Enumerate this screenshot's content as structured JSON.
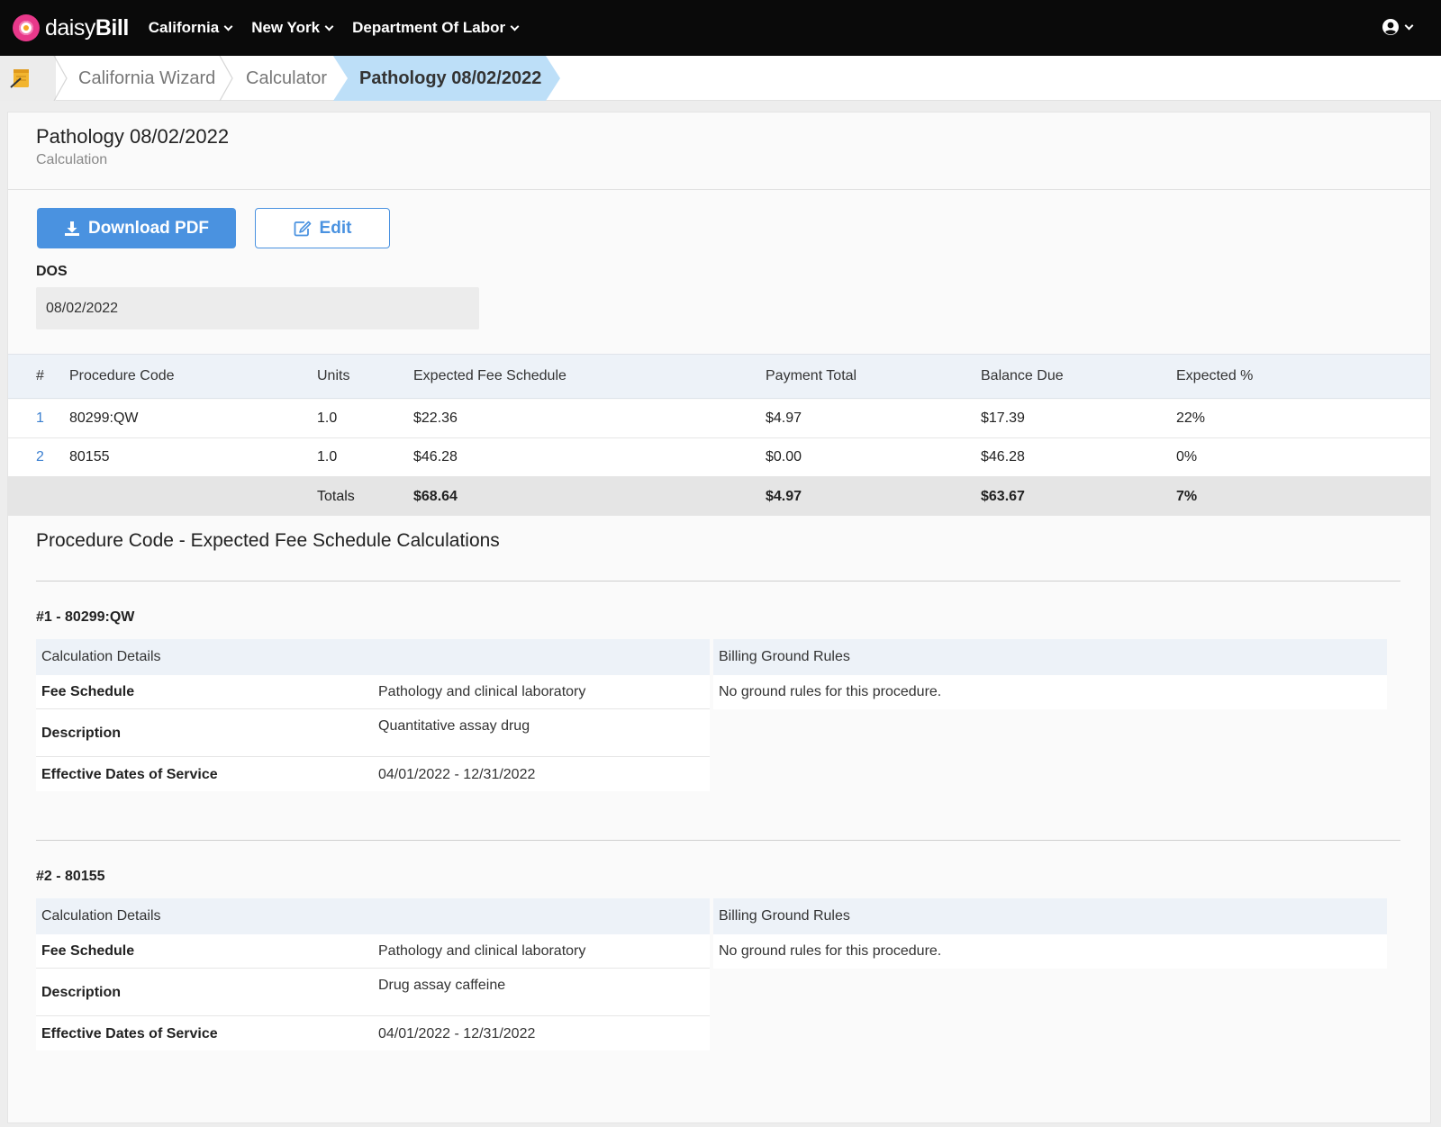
{
  "brand": {
    "name_light": "daisy",
    "name_bold": "Bill"
  },
  "nav": [
    {
      "label": "California"
    },
    {
      "label": "New York"
    },
    {
      "label": "Department Of Labor"
    }
  ],
  "breadcrumb": [
    {
      "label": "California Wizard"
    },
    {
      "label": "Calculator"
    },
    {
      "label": "Pathology 08/02/2022"
    }
  ],
  "page": {
    "title": "Pathology 08/02/2022",
    "subtitle": "Calculation"
  },
  "actions": {
    "download_label": "Download PDF",
    "edit_label": "Edit"
  },
  "dos": {
    "label": "DOS",
    "value": "08/02/2022"
  },
  "summary": {
    "headers": [
      "#",
      "Procedure Code",
      "Units",
      "Expected Fee Schedule",
      "Payment Total",
      "Balance Due",
      "Expected %"
    ],
    "rows": [
      {
        "index": "1",
        "code": "80299:QW",
        "units": "1.0",
        "expected": "$22.36",
        "payment": "$4.97",
        "balance": "$17.39",
        "pct": "22%"
      },
      {
        "index": "2",
        "code": "80155",
        "units": "1.0",
        "expected": "$46.28",
        "payment": "$0.00",
        "balance": "$46.28",
        "pct": "0%"
      }
    ],
    "totals": {
      "label": "Totals",
      "expected": "$68.64",
      "payment": "$4.97",
      "balance": "$63.67",
      "pct": "7%"
    }
  },
  "calculations": {
    "title": "Procedure Code - Expected Fee Schedule Calculations",
    "details_heading": "Calculation Details",
    "rules_heading": "Billing Ground Rules",
    "keys": {
      "fee_schedule": "Fee Schedule",
      "description": "Description",
      "effective": "Effective Dates of Service"
    },
    "procedures": [
      {
        "title": "#1 - 80299:QW",
        "fee_schedule": "Pathology and clinical laboratory",
        "description": "Quantitative assay drug",
        "effective": "04/01/2022 - 12/31/2022",
        "rules": "No ground rules for this procedure."
      },
      {
        "title": "#2 - 80155",
        "fee_schedule": "Pathology and clinical laboratory",
        "description": "Drug assay caffeine",
        "effective": "04/01/2022 - 12/31/2022",
        "rules": "No ground rules for this procedure."
      }
    ]
  },
  "colors": {
    "primary": "#4a92e0",
    "active_crumb": "#bddff8",
    "nav_bg": "#0a0a0a",
    "logo_pink": "#e8388a"
  },
  "icons": [
    "daisy-logo-icon",
    "chevron-down-icon",
    "user-circle-icon",
    "notepad-icon",
    "download-icon",
    "edit-icon"
  ]
}
